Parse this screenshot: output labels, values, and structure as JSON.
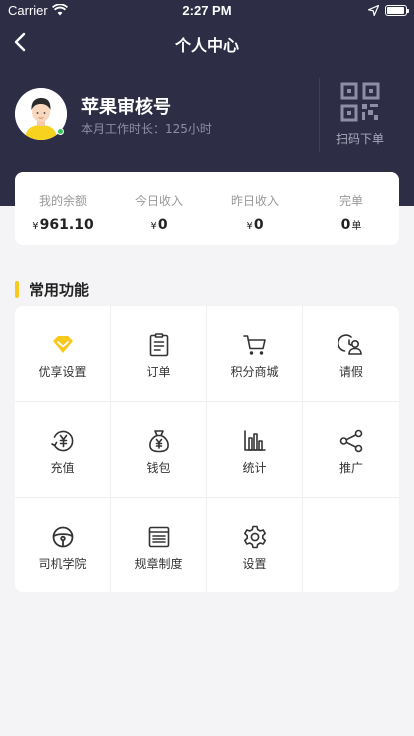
{
  "status_bar": {
    "carrier": "Carrier",
    "time": "2:27 PM"
  },
  "header": {
    "title": "个人中心"
  },
  "profile": {
    "name": "苹果审核号",
    "work_time_label": "本月工作时长：",
    "work_time_value": "125小时",
    "scan_label": "扫码下单"
  },
  "stats": [
    {
      "label": "我的余额",
      "currency": "¥",
      "value": "961.10",
      "unit": ""
    },
    {
      "label": "今日收入",
      "currency": "¥",
      "value": "0",
      "unit": ""
    },
    {
      "label": "昨日收入",
      "currency": "¥",
      "value": "0",
      "unit": ""
    },
    {
      "label": "完单",
      "currency": "",
      "value": "0",
      "unit": "单"
    }
  ],
  "section": {
    "title": "常用功能"
  },
  "functions": [
    {
      "label": "优享设置",
      "icon": "diamond-icon"
    },
    {
      "label": "订单",
      "icon": "clipboard-icon"
    },
    {
      "label": "积分商城",
      "icon": "cart-icon"
    },
    {
      "label": "请假",
      "icon": "leave-person-icon"
    },
    {
      "label": "充值",
      "icon": "recharge-icon"
    },
    {
      "label": "钱包",
      "icon": "money-bag-icon"
    },
    {
      "label": "统计",
      "icon": "bar-chart-icon"
    },
    {
      "label": "推广",
      "icon": "share-icon"
    },
    {
      "label": "司机学院",
      "icon": "steering-wheel-icon"
    },
    {
      "label": "规章制度",
      "icon": "document-list-icon"
    },
    {
      "label": "设置",
      "icon": "gear-icon"
    }
  ],
  "colors": {
    "header_bg": "#2d2e46",
    "accent": "#f6c91c",
    "online": "#35c45a"
  }
}
